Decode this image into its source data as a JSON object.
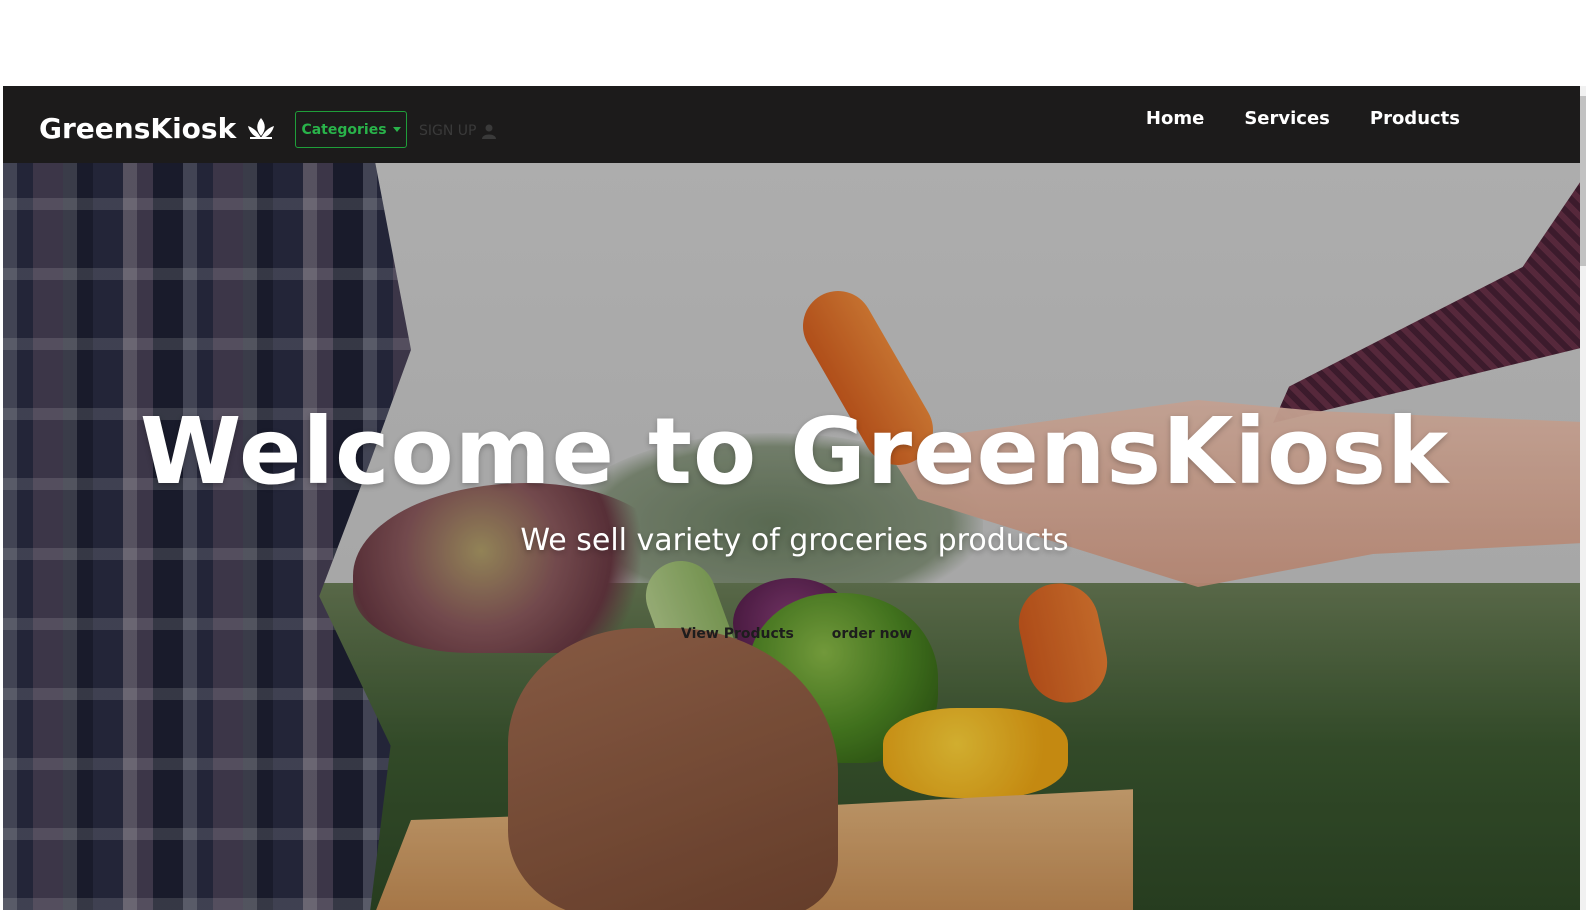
{
  "navbar": {
    "brand": "GreensKiosk",
    "brand_icon": "lotus-icon",
    "categories_label": "Categories",
    "signup_label": "SIGN UP",
    "signup_icon": "user-icon",
    "links": [
      "Home",
      "Services",
      "Products"
    ]
  },
  "hero": {
    "title": "Welcome to GreensKiosk",
    "subtitle": "We sell variety of groceries products",
    "primary_action": "View Products",
    "secondary_action": "order now"
  },
  "colors": {
    "navbar_bg": "#1c1b1b",
    "accent_green": "#29b34a",
    "text_white": "#ffffff"
  }
}
